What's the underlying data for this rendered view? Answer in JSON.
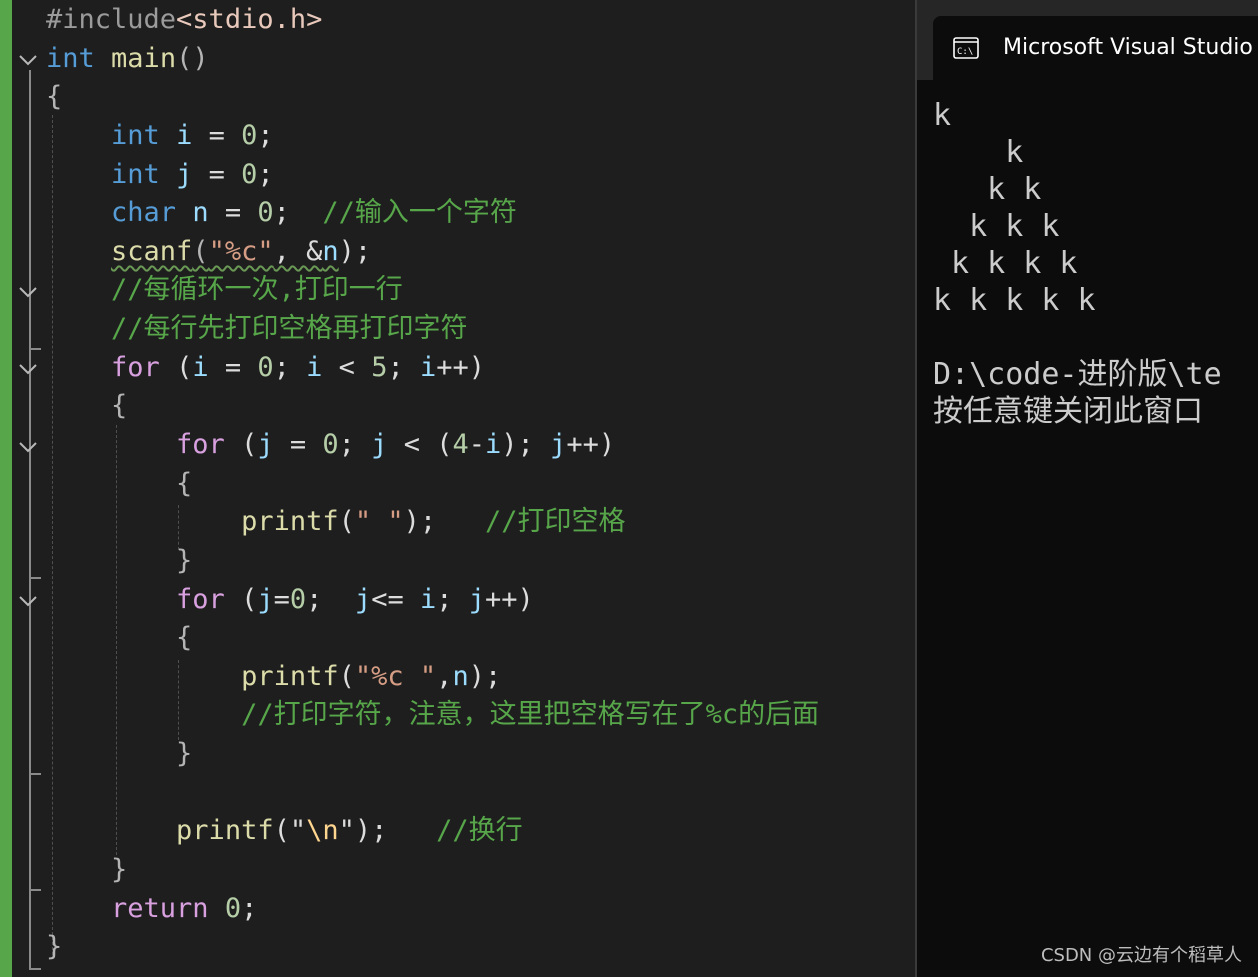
{
  "editor": {
    "lines": [
      [
        {
          "t": "#include",
          "c": "pp"
        },
        {
          "t": "<stdio.h>",
          "c": "hdr"
        }
      ],
      [
        {
          "t": "int",
          "c": "kw"
        },
        {
          "t": " "
        },
        {
          "t": "main",
          "c": "fn"
        },
        {
          "t": "()",
          "c": "pn"
        }
      ],
      [
        {
          "t": "{",
          "c": "pn"
        }
      ],
      [
        {
          "t": "    "
        },
        {
          "t": "int",
          "c": "kw"
        },
        {
          "t": " "
        },
        {
          "t": "i",
          "c": "var"
        },
        {
          "t": " = "
        },
        {
          "t": "0",
          "c": "num"
        },
        {
          "t": ";"
        }
      ],
      [
        {
          "t": "    "
        },
        {
          "t": "int",
          "c": "kw"
        },
        {
          "t": " "
        },
        {
          "t": "j",
          "c": "var"
        },
        {
          "t": " = "
        },
        {
          "t": "0",
          "c": "num"
        },
        {
          "t": ";"
        }
      ],
      [
        {
          "t": "    "
        },
        {
          "t": "char",
          "c": "kw"
        },
        {
          "t": " "
        },
        {
          "t": "n",
          "c": "var"
        },
        {
          "t": " = "
        },
        {
          "t": "0",
          "c": "num"
        },
        {
          "t": ";  "
        },
        {
          "t": "//输入一个字符",
          "c": "cm"
        }
      ],
      [
        {
          "t": "    "
        },
        {
          "t": "scanf",
          "c": "fn squiggle"
        },
        {
          "t": "(",
          "c": "pn squiggle"
        },
        {
          "t": "\"%c\"",
          "c": "str squiggle"
        },
        {
          "t": ", &",
          "c": "squiggle"
        },
        {
          "t": "n",
          "c": "var squiggle"
        },
        {
          "t": ");"
        }
      ],
      [
        {
          "t": "    "
        },
        {
          "t": "//每循环一次,打印一行",
          "c": "cm"
        }
      ],
      [
        {
          "t": "    "
        },
        {
          "t": "//每行先打印空格再打印字符",
          "c": "cm"
        }
      ],
      [
        {
          "t": "    "
        },
        {
          "t": "for",
          "c": "kw2"
        },
        {
          "t": " ("
        },
        {
          "t": "i",
          "c": "var"
        },
        {
          "t": " = "
        },
        {
          "t": "0",
          "c": "num"
        },
        {
          "t": "; "
        },
        {
          "t": "i",
          "c": "var"
        },
        {
          "t": " < "
        },
        {
          "t": "5",
          "c": "num"
        },
        {
          "t": "; "
        },
        {
          "t": "i",
          "c": "var"
        },
        {
          "t": "++)"
        }
      ],
      [
        {
          "t": "    "
        },
        {
          "t": "{",
          "c": "pn"
        }
      ],
      [
        {
          "t": "        "
        },
        {
          "t": "for",
          "c": "kw2"
        },
        {
          "t": " ("
        },
        {
          "t": "j",
          "c": "var"
        },
        {
          "t": " = "
        },
        {
          "t": "0",
          "c": "num"
        },
        {
          "t": "; "
        },
        {
          "t": "j",
          "c": "var"
        },
        {
          "t": " < ("
        },
        {
          "t": "4",
          "c": "num"
        },
        {
          "t": "-"
        },
        {
          "t": "i",
          "c": "var"
        },
        {
          "t": "); "
        },
        {
          "t": "j",
          "c": "var"
        },
        {
          "t": "++)"
        }
      ],
      [
        {
          "t": "        "
        },
        {
          "t": "{",
          "c": "pn"
        }
      ],
      [
        {
          "t": "            "
        },
        {
          "t": "printf",
          "c": "fn"
        },
        {
          "t": "("
        },
        {
          "t": "\" \"",
          "c": "str"
        },
        {
          "t": ");   "
        },
        {
          "t": "//打印空格",
          "c": "cm"
        }
      ],
      [
        {
          "t": "        "
        },
        {
          "t": "}",
          "c": "pn"
        }
      ],
      [
        {
          "t": "        "
        },
        {
          "t": "for",
          "c": "kw2"
        },
        {
          "t": " ("
        },
        {
          "t": "j",
          "c": "var"
        },
        {
          "t": "="
        },
        {
          "t": "0",
          "c": "num"
        },
        {
          "t": ";  "
        },
        {
          "t": "j",
          "c": "var"
        },
        {
          "t": "<= "
        },
        {
          "t": "i",
          "c": "var"
        },
        {
          "t": "; "
        },
        {
          "t": "j",
          "c": "var"
        },
        {
          "t": "++)"
        }
      ],
      [
        {
          "t": "        "
        },
        {
          "t": "{",
          "c": "pn"
        }
      ],
      [
        {
          "t": "            "
        },
        {
          "t": "printf",
          "c": "fn"
        },
        {
          "t": "("
        },
        {
          "t": "\"%c \"",
          "c": "str"
        },
        {
          "t": ","
        },
        {
          "t": "n",
          "c": "var"
        },
        {
          "t": ");"
        }
      ],
      [
        {
          "t": "            "
        },
        {
          "t": "//打印字符，注意，这里把空格写在了%c的后面",
          "c": "cm"
        }
      ],
      [
        {
          "t": "        "
        },
        {
          "t": "}",
          "c": "pn"
        }
      ],
      [],
      [
        {
          "t": "        "
        },
        {
          "t": "printf",
          "c": "fn"
        },
        {
          "t": "(\""
        },
        {
          "t": "\\n",
          "c": "esc"
        },
        {
          "t": "\");   "
        },
        {
          "t": "//换行",
          "c": "cm"
        }
      ],
      [
        {
          "t": "    "
        },
        {
          "t": "}",
          "c": "pn"
        }
      ],
      [
        {
          "t": "    "
        },
        {
          "t": "return",
          "c": "kw2"
        },
        {
          "t": " "
        },
        {
          "t": "0",
          "c": "num"
        },
        {
          "t": ";"
        }
      ],
      [
        {
          "t": "}",
          "c": "pn"
        }
      ]
    ]
  },
  "console": {
    "title": "Microsoft Visual Studio",
    "icon": "cmd-icon",
    "output_lines": [
      "k",
      "    k",
      "   k k",
      "  k k k",
      " k k k k",
      "k k k k k",
      "",
      "D:\\code-进阶版\\te",
      "按任意键关闭此窗口"
    ]
  },
  "watermark": "CSDN @云边有个稻草人",
  "colors": {
    "editor_bg": "#1e1e1e",
    "console_bg": "#0c0c0c",
    "keyword": "#569cd6",
    "control_keyword": "#d8a0df",
    "function": "#dcdcaa",
    "variable": "#9cdcfe",
    "number": "#b5cea8",
    "string": "#d69d85",
    "comment": "#57a64a",
    "change_bar": "#57a64a"
  }
}
